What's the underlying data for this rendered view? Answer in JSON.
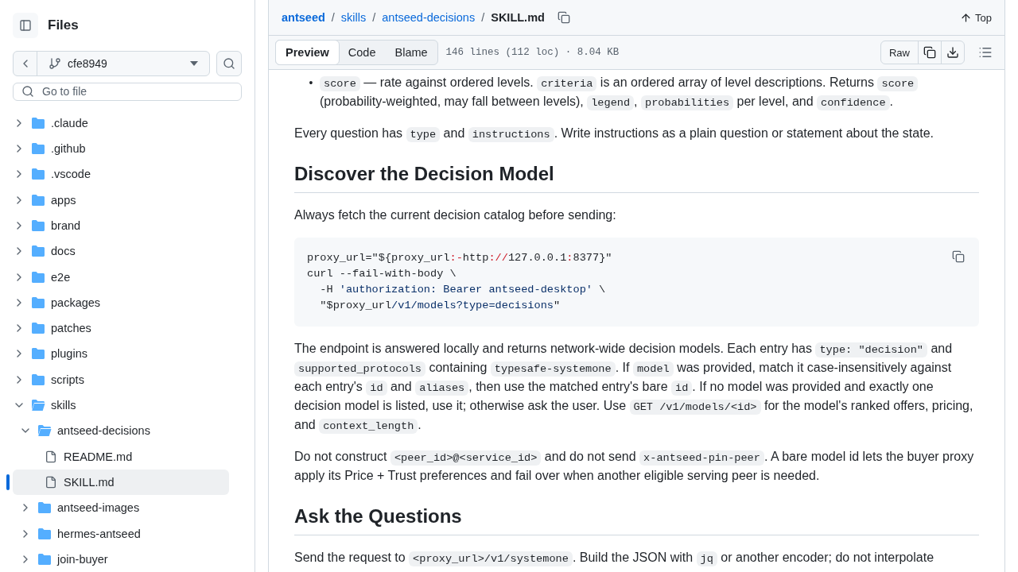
{
  "sidebar": {
    "title": "Files",
    "branch": "cfe8949",
    "search": {
      "placeholder": "Go to file"
    },
    "tree": [
      {
        "kind": "folder",
        "name": ".claude",
        "expanded": false,
        "selected": false
      },
      {
        "kind": "folder",
        "name": ".github",
        "expanded": false,
        "selected": false
      },
      {
        "kind": "folder",
        "name": ".vscode",
        "expanded": false,
        "selected": false
      },
      {
        "kind": "folder",
        "name": "apps",
        "expanded": false,
        "selected": false
      },
      {
        "kind": "folder",
        "name": "brand",
        "expanded": false,
        "selected": false
      },
      {
        "kind": "folder",
        "name": "docs",
        "expanded": false,
        "selected": false
      },
      {
        "kind": "folder",
        "name": "e2e",
        "expanded": false,
        "selected": false
      },
      {
        "kind": "folder",
        "name": "packages",
        "expanded": false,
        "selected": false
      },
      {
        "kind": "folder",
        "name": "patches",
        "expanded": false,
        "selected": false
      },
      {
        "kind": "folder",
        "name": "plugins",
        "expanded": false,
        "selected": false
      },
      {
        "kind": "folder",
        "name": "scripts",
        "expanded": false,
        "selected": false
      },
      {
        "kind": "folder",
        "name": "skills",
        "expanded": true,
        "selected": false,
        "children": [
          {
            "kind": "folder",
            "name": "antseed-decisions",
            "expanded": true,
            "selected": false,
            "children": [
              {
                "kind": "file",
                "name": "README.md",
                "selected": false
              },
              {
                "kind": "file",
                "name": "SKILL.md",
                "selected": true
              }
            ]
          },
          {
            "kind": "folder",
            "name": "antseed-images",
            "expanded": false,
            "selected": false
          },
          {
            "kind": "folder",
            "name": "hermes-antseed",
            "expanded": false,
            "selected": false
          },
          {
            "kind": "folder",
            "name": "join-buyer",
            "expanded": false,
            "selected": false
          }
        ]
      }
    ]
  },
  "breadcrumb": [
    {
      "kind": "link",
      "text": "antseed"
    },
    {
      "kind": "separator",
      "text": "/"
    },
    {
      "kind": "link",
      "text": "skills"
    },
    {
      "kind": "separator",
      "text": "/"
    },
    {
      "kind": "link",
      "text": "antseed-decisions"
    },
    {
      "kind": "separator",
      "text": "/"
    },
    {
      "kind": "current",
      "text": "SKILL.md"
    }
  ],
  "top_link": "Top",
  "tabs": [
    {
      "label": "Preview",
      "selected": true
    },
    {
      "label": "Code",
      "selected": false
    },
    {
      "label": "Blame",
      "selected": false
    }
  ],
  "file_info": "146 lines (112 loc) · 8.04 KB",
  "raw_button": "Raw",
  "content": [
    {
      "kind": "bullet",
      "marker": "•",
      "segments": [
        {
          "kind": "code",
          "text": "score"
        },
        {
          "kind": "text",
          "text": " — rate against ordered levels. "
        },
        {
          "kind": "code",
          "text": "criteria"
        },
        {
          "kind": "text",
          "text": " is an ordered array of level descriptions. Returns "
        },
        {
          "kind": "code",
          "text": "score"
        },
        {
          "kind": "text",
          "text": " (probability-weighted, may fall between levels), "
        },
        {
          "kind": "code",
          "text": "legend"
        },
        {
          "kind": "text",
          "text": ", "
        },
        {
          "kind": "code",
          "text": "probabilities"
        },
        {
          "kind": "text",
          "text": " per level, and "
        },
        {
          "kind": "code",
          "text": "confidence"
        },
        {
          "kind": "text",
          "text": "."
        }
      ]
    },
    {
      "kind": "paragraph",
      "segments": [
        {
          "kind": "text",
          "text": "Every question has "
        },
        {
          "kind": "code",
          "text": "type"
        },
        {
          "kind": "text",
          "text": " and "
        },
        {
          "kind": "code",
          "text": "instructions"
        },
        {
          "kind": "text",
          "text": ". Write instructions as a plain question or statement about the state."
        }
      ]
    },
    {
      "kind": "heading",
      "text": "Discover the Decision Model"
    },
    {
      "kind": "paragraph",
      "segments": [
        {
          "kind": "text",
          "text": "Always fetch the current decision catalog before sending:"
        }
      ]
    },
    {
      "kind": "code",
      "lines": [
        [
          {
            "kind": "plain",
            "text": "proxy_url=\"${proxy_url"
          },
          {
            "kind": "punct",
            "text": ":-"
          },
          {
            "kind": "plain",
            "text": "http"
          },
          {
            "kind": "punct",
            "text": "://"
          },
          {
            "kind": "plain",
            "text": "127.0.0.1"
          },
          {
            "kind": "punct",
            "text": ":"
          },
          {
            "kind": "plain",
            "text": "8377}\""
          }
        ],
        [
          {
            "kind": "plain",
            "text": "curl --fail-with-body \\"
          }
        ],
        [
          {
            "kind": "plain",
            "text": "  -H "
          },
          {
            "kind": "string",
            "text": "'authorization: Bearer antseed-desktop'"
          },
          {
            "kind": "plain",
            "text": " \\"
          }
        ],
        [
          {
            "kind": "plain",
            "text": "  \"$proxy_url"
          },
          {
            "kind": "string",
            "text": "/v1/models?type=decisions"
          },
          {
            "kind": "plain",
            "text": "\""
          }
        ]
      ]
    },
    {
      "kind": "paragraph",
      "segments": [
        {
          "kind": "text",
          "text": "The endpoint is answered locally and returns network-wide decision models. Each entry has "
        },
        {
          "kind": "code",
          "text": "type: \"decision\""
        },
        {
          "kind": "text",
          "text": " and "
        },
        {
          "kind": "code",
          "text": "supported_protocols"
        },
        {
          "kind": "text",
          "text": " containing "
        },
        {
          "kind": "code",
          "text": "typesafe-systemone"
        },
        {
          "kind": "text",
          "text": ". If "
        },
        {
          "kind": "code",
          "text": "model"
        },
        {
          "kind": "text",
          "text": " was provided, match it case-insensitively against each entry's "
        },
        {
          "kind": "code",
          "text": "id"
        },
        {
          "kind": "text",
          "text": " and "
        },
        {
          "kind": "code",
          "text": "aliases"
        },
        {
          "kind": "text",
          "text": ", then use the matched entry's bare "
        },
        {
          "kind": "code",
          "text": "id"
        },
        {
          "kind": "text",
          "text": ". If no model was provided and exactly one decision model is listed, use it; otherwise ask the user. Use "
        },
        {
          "kind": "code",
          "text": "GET /v1/models/<id>"
        },
        {
          "kind": "text",
          "text": " for the model's ranked offers, pricing, and "
        },
        {
          "kind": "code",
          "text": "context_length"
        },
        {
          "kind": "text",
          "text": "."
        }
      ]
    },
    {
      "kind": "paragraph",
      "segments": [
        {
          "kind": "text",
          "text": "Do not construct "
        },
        {
          "kind": "code",
          "text": "<peer_id>@<service_id>"
        },
        {
          "kind": "text",
          "text": " and do not send "
        },
        {
          "kind": "code",
          "text": "x-antseed-pin-peer"
        },
        {
          "kind": "text",
          "text": ". A bare model id lets the buyer proxy apply its Price + Trust preferences and fail over when another eligible serving peer is needed."
        }
      ]
    },
    {
      "kind": "heading",
      "text": "Ask the Questions"
    },
    {
      "kind": "paragraph",
      "segments": [
        {
          "kind": "text",
          "text": "Send the request to "
        },
        {
          "kind": "code",
          "text": "<proxy_url>/v1/systemone"
        },
        {
          "kind": "text",
          "text": ". Build the JSON with "
        },
        {
          "kind": "code",
          "text": "jq"
        },
        {
          "kind": "text",
          "text": " or another encoder; do not interpolate"
        }
      ]
    }
  ]
}
